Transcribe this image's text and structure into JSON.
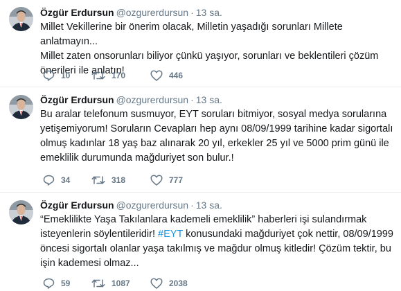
{
  "tweets": [
    {
      "name": "Özgür Erdursun",
      "handle": "@ozgurerdursun",
      "separator": "·",
      "time": "13 sa.",
      "lines": [
        "Millet Vekillerine bir önerim olacak, Milletin yaşadığı sorunları Millete anlatmayın...",
        "Millet zaten onsorunları biliyor çünkü yaşıyor, sorunları ve beklentileri çözüm",
        "önerileri ile anlatın!"
      ],
      "replies": "10",
      "retweets": "170",
      "likes": "446"
    },
    {
      "name": "Özgür Erdursun",
      "handle": "@ozgurerdursun",
      "separator": "·",
      "time": "13 sa.",
      "lines": [
        "Bu aralar telefonum susmuyor, EYT soruları bitmiyor, sosyal medya sorularına",
        "yetişemiyorum! Soruların Cevapları hep aynı 08/09/1999 tarihine kadar sigortalı",
        "olmuş kadınlar 18 yaş baz alınarak 20 yıl, erkekler 25 yıl ve 5000 prim günü ile",
        "emeklilik durumunda mağduriyet son bulur.!"
      ],
      "replies": "34",
      "retweets": "318",
      "likes": "777"
    },
    {
      "name": "Özgür Erdursun",
      "handle": "@ozgurerdursun",
      "separator": "·",
      "time": "13 sa.",
      "line1": "“Emeklilikte Yaşa Takılanlara kademeli emeklilik” haberleri işi sulandırmak",
      "line2_before": "isteyenlerin söylentileridir! ",
      "hashtag": "#EYT",
      "line2_after": " konusundaki mağduriyet çok nettir, 08/09/1999",
      "line3": "öncesi sigortalı olanlar yaşa takılmış ve mağdur olmuş kitledir! Çözüm tektir, bu",
      "line4": "işin kademesi olmaz...",
      "replies": "59",
      "retweets": "1087",
      "likes": "2038"
    }
  ],
  "colors": {
    "text": "#14171a",
    "muted": "#657786",
    "link": "#1b95e0",
    "divider": "#e6ecf0"
  },
  "icons": {
    "reply": "reply-icon",
    "retweet": "retweet-icon",
    "like": "heart-icon"
  }
}
